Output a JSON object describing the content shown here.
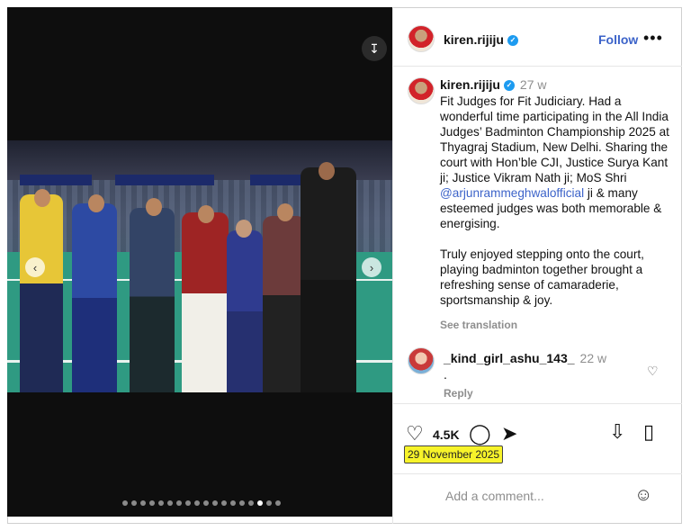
{
  "header": {
    "username": "kiren.rijiju",
    "follow_label": "Follow",
    "more_label": "•••"
  },
  "post": {
    "username": "kiren.rijiju",
    "time_ago": "27 w",
    "caption_part1": "Fit Judges for Fit Judiciary. Had a wonderful time participating in the All India Judges’ Badminton Championship 2025 at Thyagraj Stadium, New Delhi. Sharing the court with Hon’ble CJI, Justice Surya Kant ji; Justice Vikram Nath ji; MoS Shri ",
    "mention": "@arjunrammeghwalofficial",
    "caption_part2": " ji & many esteemed judges was both memorable & energising.\n\nTruly enjoyed stepping onto the court, playing badminton together brought a refreshing sense of camaraderie, sportsmanship & joy.",
    "see_translation": "See translation"
  },
  "comment": {
    "username": "_kind_girl_ashu_143_",
    "time_ago": "22 w",
    "text": ".",
    "reply_label": "Reply"
  },
  "actions": {
    "like_count": "4.5K",
    "date": "29 November 2025"
  },
  "comment_box": {
    "placeholder": "Add a comment..."
  },
  "media": {
    "dot_count": 18,
    "active_dot": 15
  },
  "colors": {
    "link_blue": "#3c63c9",
    "verified_blue": "#1d9bf0",
    "date_highlight": "#f7f32a",
    "media_background": "#0e0e0e"
  },
  "icons": [
    "download-icon",
    "chevron-left-icon",
    "chevron-right-icon",
    "verified-icon",
    "more-icon",
    "heart-icon",
    "comment-icon",
    "share-icon",
    "repost-icon",
    "bookmark-icon",
    "emoji-icon"
  ]
}
